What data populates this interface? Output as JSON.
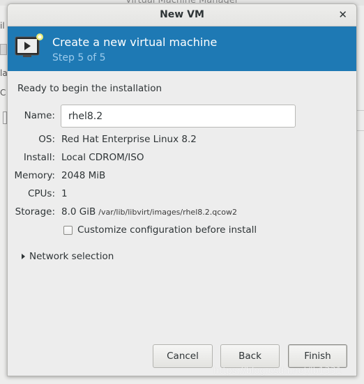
{
  "background_window": {
    "title": "Virtual Machine Manager",
    "left_snippets": [
      "il",
      "la",
      "C"
    ]
  },
  "dialog": {
    "title": "New VM",
    "close_icon": "close-icon"
  },
  "banner": {
    "title": "Create a new virtual machine",
    "step": "Step 5 of 5",
    "icon": "monitor-icon",
    "colors": {
      "background": "#1e79b4",
      "step_text": "#9ccbec"
    }
  },
  "summary": {
    "ready_text": "Ready to begin the installation",
    "name_label": "Name:",
    "name_value": "rhel8.2",
    "os_label": "OS:",
    "os_value": "Red Hat Enterprise Linux 8.2",
    "install_label": "Install:",
    "install_value": "Local CDROM/ISO",
    "memory_label": "Memory:",
    "memory_value": "2048 MiB",
    "cpus_label": "CPUs:",
    "cpus_value": "1",
    "storage_label": "Storage:",
    "storage_size": "8.0 GiB",
    "storage_path": "/var/lib/libvirt/images/rhel8.2.qcow2",
    "customize_label": "Customize configuration before install",
    "customize_checked": false,
    "network_label": "Network selection"
  },
  "buttons": {
    "cancel": "Cancel",
    "back": "Back",
    "finish": "Finish"
  },
  "watermark": "https://blog.csdn.net/lb1331"
}
